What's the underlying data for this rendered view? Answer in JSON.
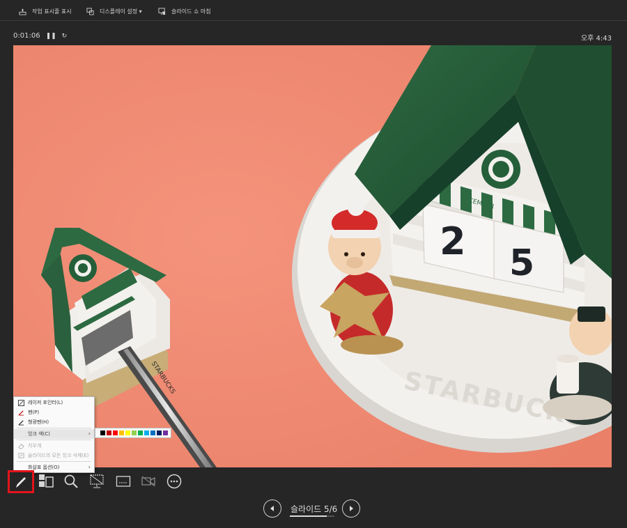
{
  "topbar": {
    "show_taskbar": "작업 표시줄 표시",
    "display_settings": "디스플레이 설정 ▾",
    "end_slideshow": "슬라이드 쇼 마침"
  },
  "timer": {
    "elapsed": "0:01:06",
    "pause_icon": "pause-icon",
    "restart_icon": "restart-icon"
  },
  "clock": {
    "time": "오후 4:43"
  },
  "slide": {
    "date_numbers": [
      "2",
      "5"
    ],
    "base_text": "STARBUCKS",
    "tag_text": "DECEMBER",
    "pen_text": "STARBUCKS"
  },
  "pointer_menu": {
    "items": [
      {
        "label": "레이저 포인터(L)",
        "icon": "laser-pointer-icon",
        "enabled": true
      },
      {
        "label": "펜(P)",
        "icon": "pen-icon",
        "enabled": true
      },
      {
        "label": "형광펜(H)",
        "icon": "highlighter-icon",
        "enabled": true
      },
      {
        "label": "잉크 색(C)",
        "icon": "",
        "enabled": true,
        "submenu": true
      },
      {
        "label": "지우개",
        "icon": "eraser-icon",
        "enabled": false
      },
      {
        "label": "슬라이드의 모든 잉크 삭제(E)",
        "icon": "erase-all-ink-icon",
        "enabled": false
      },
      {
        "label": "화살표 옵션(O)",
        "icon": "",
        "enabled": true,
        "submenu": true
      }
    ],
    "ink_colors": [
      "#000000",
      "#c00000",
      "#ff0000",
      "#ffc000",
      "#ffff00",
      "#92d050",
      "#00b050",
      "#00b0f0",
      "#0070c0",
      "#002060",
      "#7030a0"
    ]
  },
  "toolbar": {
    "icons": [
      "pen-tool-icon",
      "see-all-slides-icon",
      "zoom-icon",
      "black-screen-icon",
      "subtitles-icon",
      "camera-icon",
      "more-options-icon"
    ]
  },
  "nav": {
    "label": "슬라이드 5/6",
    "progress": 0.8333,
    "prev_icon": "previous-slide-icon",
    "next_icon": "next-slide-icon"
  },
  "colors": {
    "highlight": "#e2141b",
    "background": "#262626",
    "slide_bg": "#ef8d74"
  }
}
